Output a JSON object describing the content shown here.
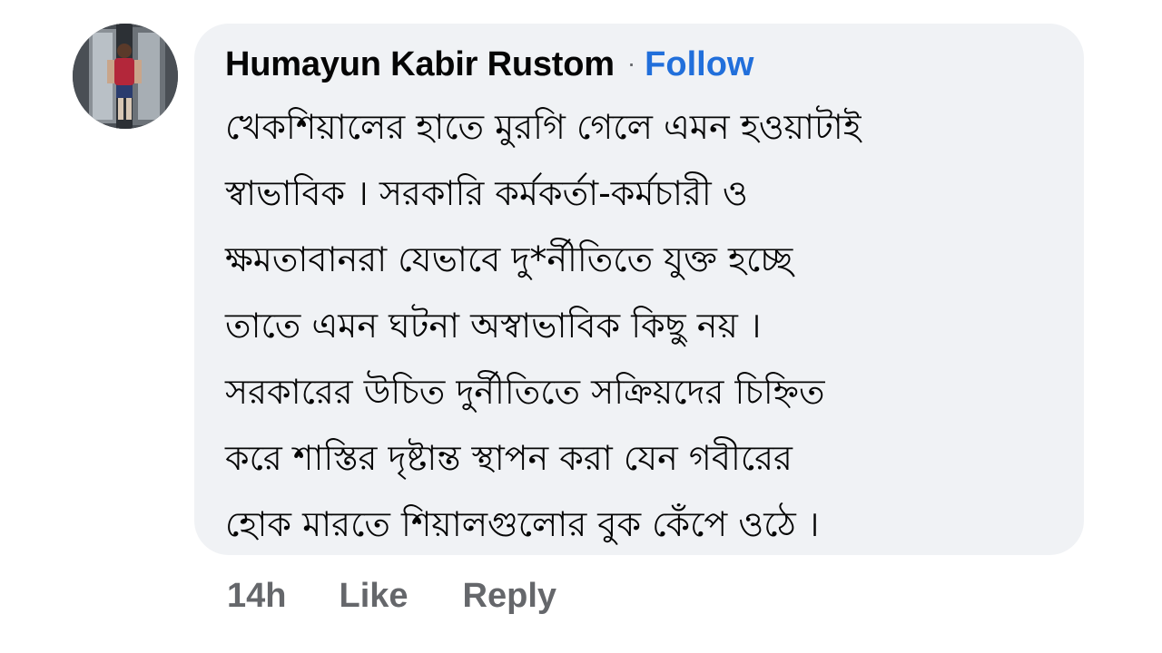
{
  "comment": {
    "author": "Humayun Kabir Rustom",
    "separator": "·",
    "follow_label": "Follow",
    "text_lines": [
      "খেকশিয়ালের হাতে মুরগি গেলে এমন হওয়াটাই",
      "স্বাভাবিক । সরকারি কর্মকর্তা-কর্মচারী ও",
      "ক্ষমতাবানরা যেভাবে দু*র্নীতিতে যুক্ত হচ্ছে",
      "তাতে এমন ঘটনা অস্বাভাবিক কিছু নয় ।",
      "সরকারের উচিত দুর্নীতিতে সক্রিয়দের চিহ্নিত",
      "করে শাস্তির দৃষ্টান্ত স্থাপন করা যেন গবীরের",
      "হোক মারতে শিয়ালগুলোর বুক কেঁপে ওঠে ।"
    ],
    "timestamp": "14h",
    "like_label": "Like",
    "reply_label": "Reply"
  },
  "colors": {
    "bubble_bg": "#f0f2f5",
    "follow": "#216fdb",
    "meta": "#65676b",
    "text": "#050505"
  }
}
